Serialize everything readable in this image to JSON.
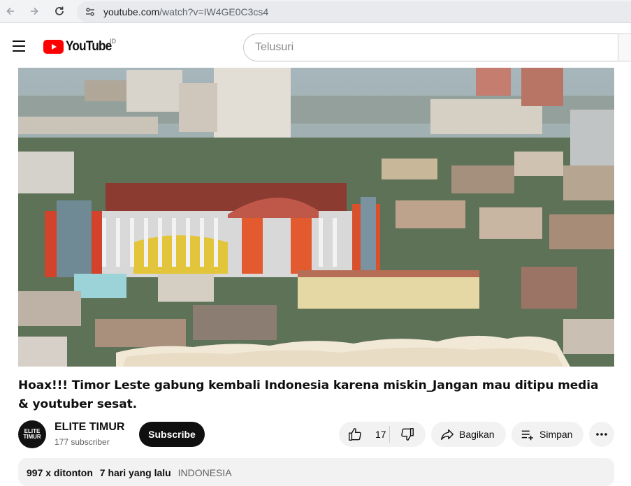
{
  "browser": {
    "url_domain": "youtube.com",
    "url_path": "/watch?v=IW4GE0C3cs4"
  },
  "header": {
    "logo_text": "YouTube",
    "country_code": "ID",
    "search_placeholder": "Telusuri"
  },
  "video": {
    "title": "Hoax!!! Timor Leste gabung kembali Indonesia karena miskin_Jangan mau ditipu media & youtuber sesat."
  },
  "channel": {
    "name": "ELITE TIMUR",
    "subscribers": "177 subscriber",
    "avatar_text": "ELITE TIMUR",
    "subscribe_label": "Subscribe"
  },
  "actions": {
    "like_count": "17",
    "share_label": "Bagikan",
    "save_label": "Simpan"
  },
  "description": {
    "views": "997 x ditonton",
    "date": "7 hari yang lalu",
    "tag": "INDONESIA"
  },
  "colors": {
    "brand_red": "#ff0000",
    "subscribe_bg": "#0f0f0f",
    "pill_bg": "#f2f2f2"
  }
}
